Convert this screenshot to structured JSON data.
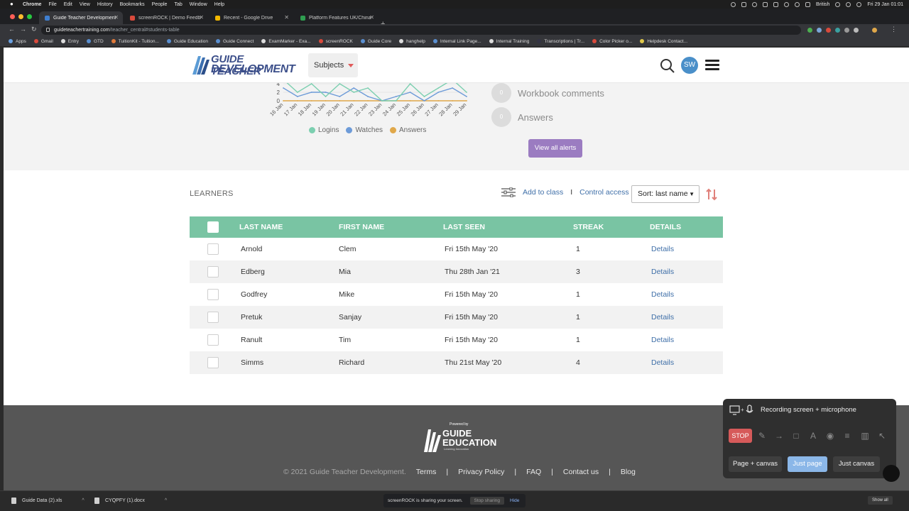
{
  "menubar": {
    "items": [
      "Chrome",
      "File",
      "Edit",
      "View",
      "History",
      "Bookmarks",
      "People",
      "Tab",
      "Window",
      "Help"
    ],
    "keyboard": "British",
    "clock": "Fri 29 Jan 01:01"
  },
  "tabs": [
    {
      "title": "Guide Teacher Development -",
      "favicon_color": "#3f7fd0",
      "active": true
    },
    {
      "title": "screenROCK | Demo Feedback",
      "favicon_color": "#d94a3c",
      "active": false
    },
    {
      "title": "Recent - Google Drive",
      "favicon_color": "#f2b800",
      "active": false
    },
    {
      "title": "Platform Features UK/China -",
      "favicon_color": "#2f9e50",
      "active": false
    }
  ],
  "newtab_label": "+",
  "address": {
    "host": "guideteachertraining.com",
    "path": "/teacher_central#students-table"
  },
  "bookmarks": [
    "Apps",
    "Gmail",
    "Entry",
    "GTD",
    "TuitionKit - Tuition...",
    "Guide Education",
    "Guide Connect",
    "ExamMarker - Exa...",
    "screenROCK",
    "Guide Core",
    "hanghelp",
    "Internal Link Page...",
    "Internal Training",
    "Transcriptions | Tr...",
    "Color Picker o...",
    "Helpdesk Contact..."
  ],
  "header": {
    "logo_line1": "GUIDE TEACHER",
    "logo_line2": "DEVELOPMENT",
    "subjects_label": "Subjects",
    "avatar_initials": "SW"
  },
  "chart_data": {
    "type": "line",
    "categories": [
      "16 Jan",
      "17 Jan",
      "18 Jan",
      "19 Jan",
      "20 Jan",
      "21 Jan",
      "22 Jan",
      "23 Jan",
      "24 Jan",
      "25 Jan",
      "26 Jan",
      "27 Jan",
      "28 Jan",
      "29 Jan"
    ],
    "y_ticks": [
      "0",
      "2",
      "4"
    ],
    "ylim": [
      0,
      5
    ],
    "series": [
      {
        "name": "Logins",
        "color": "#7ccfb0",
        "values": [
          5,
          2,
          4,
          1,
          4,
          2,
          3,
          0,
          0,
          4,
          1,
          3,
          5,
          2
        ]
      },
      {
        "name": "Watches",
        "color": "#6d9bd8",
        "values": [
          3,
          1,
          2,
          2,
          1,
          3,
          1,
          0,
          1,
          2,
          0,
          2,
          3,
          1
        ]
      },
      {
        "name": "Answers",
        "color": "#e0a84a",
        "values": [
          0,
          0,
          0,
          0,
          0,
          0,
          0,
          0,
          0,
          0,
          0,
          0,
          0,
          0
        ]
      }
    ]
  },
  "alerts": [
    {
      "count": "0",
      "label": "Workbook comments"
    },
    {
      "count": "0",
      "label": "Answers"
    }
  ],
  "view_all_alerts": "View all alerts",
  "learners": {
    "title": "LEARNERS",
    "add_to_class": "Add to class",
    "separator": "I",
    "control_access": "Control access",
    "sort_label": "Sort: last name",
    "columns": [
      "LAST NAME",
      "FIRST NAME",
      "LAST SEEN",
      "STREAK",
      "DETAILS"
    ],
    "rows": [
      {
        "last": "Arnold",
        "first": "Clem",
        "seen": "Fri 15th May '20",
        "streak": "1",
        "details": "Details"
      },
      {
        "last": "Edberg",
        "first": "Mia",
        "seen": "Thu 28th Jan '21",
        "streak": "3",
        "details": "Details"
      },
      {
        "last": "Godfrey",
        "first": "Mike",
        "seen": "Fri 15th May '20",
        "streak": "1",
        "details": "Details"
      },
      {
        "last": "Pretuk",
        "first": "Sanjay",
        "seen": "Fri 15th May '20",
        "streak": "1",
        "details": "Details"
      },
      {
        "last": "Ranult",
        "first": "Tim",
        "seen": "Fri 15th May '20",
        "streak": "1",
        "details": "Details"
      },
      {
        "last": "Simms",
        "first": "Richard",
        "seen": "Thu 21st May '20",
        "streak": "4",
        "details": "Details"
      }
    ]
  },
  "footer": {
    "powered_by": "Powered by",
    "brand1": "GUIDE",
    "brand2": "EDUCATION",
    "brand_tagline": "Learning Innovation",
    "copyright": "© 2021 Guide Teacher Development.",
    "links": [
      "Terms",
      "Privacy Policy",
      "FAQ",
      "Contact us",
      "Blog"
    ],
    "link_separator": "|"
  },
  "recorder": {
    "title": "Recording screen + microphone",
    "stop": "STOP",
    "modes": [
      "Page + canvas",
      "Just page",
      "Just canvas"
    ],
    "active_mode": "Just page"
  },
  "downloads": [
    {
      "name": "Guide Data (2).xls"
    },
    {
      "name": "CYQPFY (1).docx"
    }
  ],
  "share_bar": {
    "message": "screenROCK is sharing your screen.",
    "stop": "Stop sharing",
    "hide": "Hide"
  },
  "show_all": "Show all"
}
